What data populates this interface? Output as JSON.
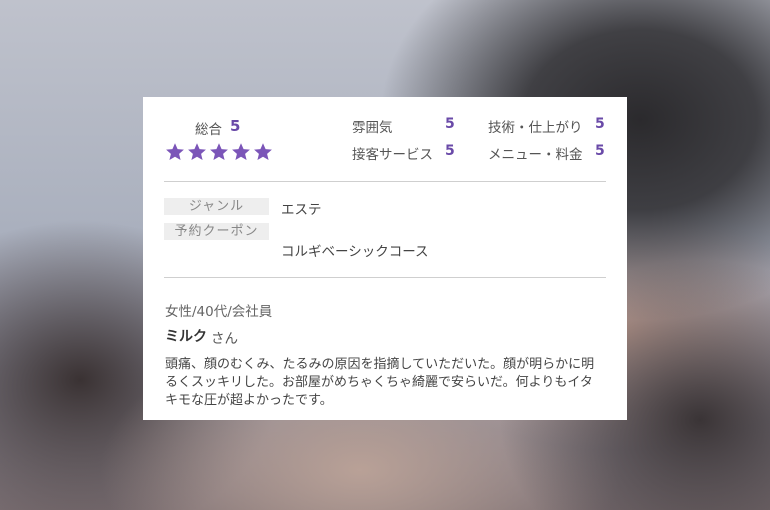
{
  "ratings": {
    "overall_label": "総合",
    "overall_value": "5",
    "stars_filled": 5,
    "star_color": "#7b55b8",
    "items": [
      {
        "label": "雰囲気",
        "value": "5"
      },
      {
        "label": "技術・仕上がり",
        "value": "5"
      },
      {
        "label": "接客サービス",
        "value": "5"
      },
      {
        "label": "メニュー・料金",
        "value": "5"
      }
    ]
  },
  "details": {
    "genre_label": "ジャンル",
    "genre_value": "エステ",
    "coupon_label": "予約クーポン",
    "coupon_value": "コルギベーシックコース"
  },
  "reviewer": {
    "profile": "女性/40代/会社員",
    "name": "ミルク",
    "honorific": "さん"
  },
  "review_text": "頭痛、顔のむくみ、たるみの原因を指摘していただいた。顔が明らかに明るくスッキリした。お部屋がめちゃくちゃ綺麗で安らいだ。何よりもイタキモな圧が超よかったです。"
}
